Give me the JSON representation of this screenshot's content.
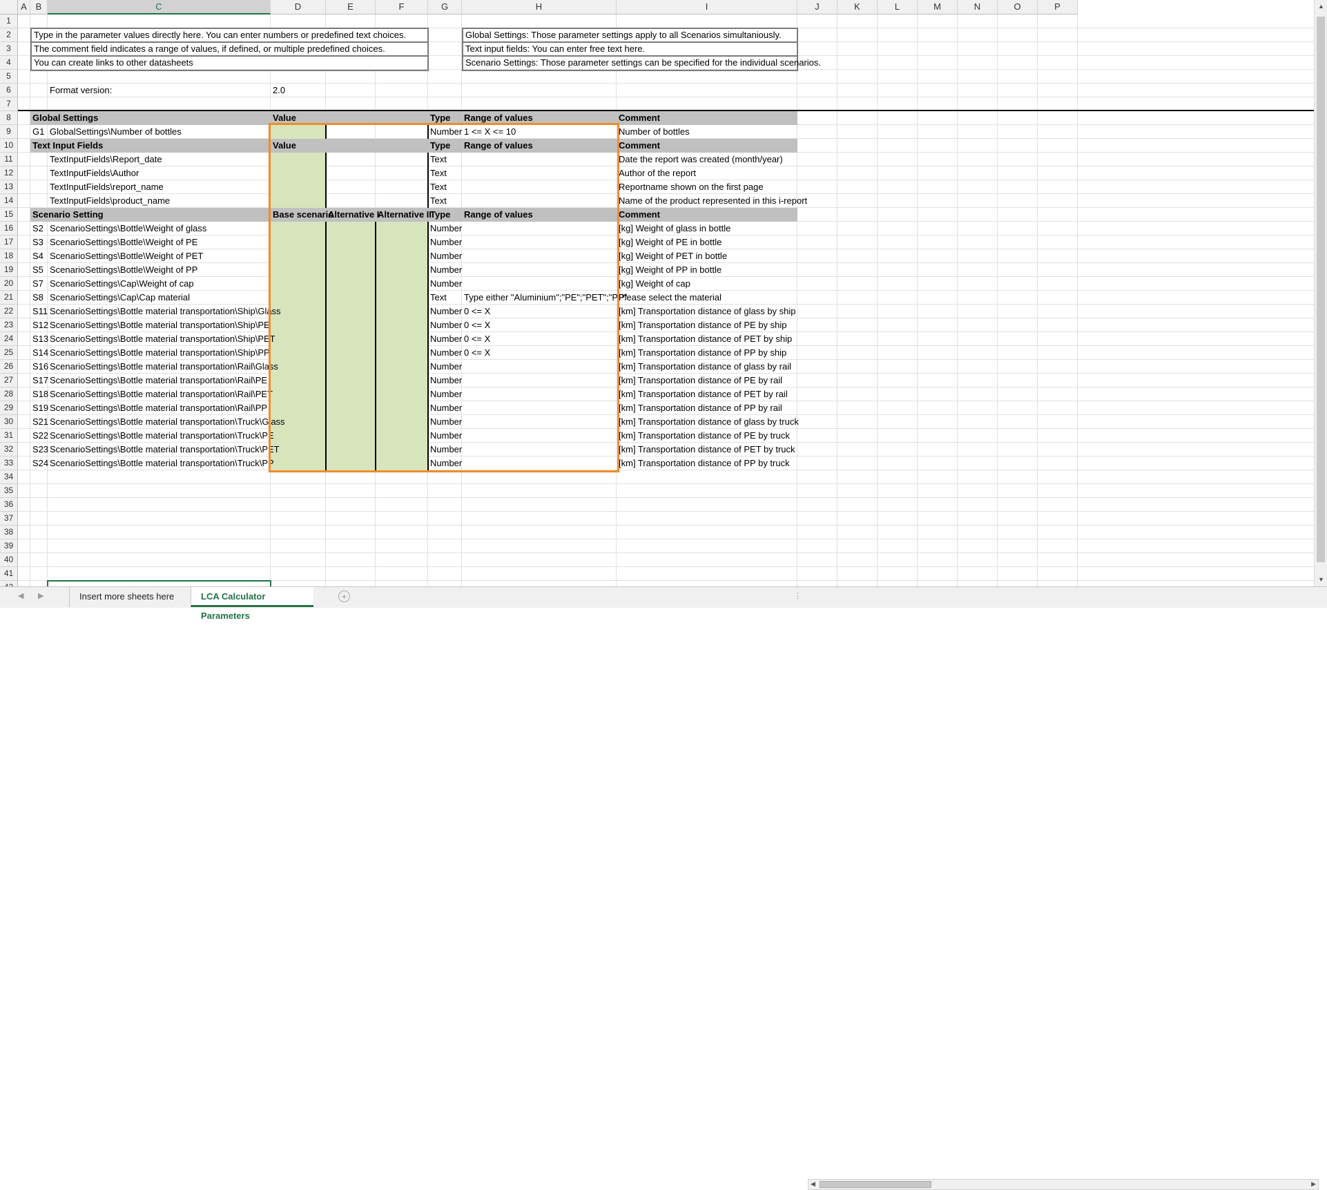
{
  "columns": [
    "A",
    "B",
    "C",
    "D",
    "E",
    "F",
    "G",
    "H",
    "I",
    "J",
    "K",
    "L",
    "M",
    "N",
    "O",
    "P"
  ],
  "row_numbers": [
    "1",
    "2",
    "3",
    "4",
    "5",
    "6",
    "7",
    "8",
    "9",
    "10",
    "11",
    "12",
    "13",
    "14",
    "15",
    "16",
    "17",
    "18",
    "19",
    "20",
    "21",
    "22",
    "23",
    "24",
    "25",
    "26",
    "27",
    "28",
    "29",
    "30",
    "31",
    "32",
    "33",
    "34",
    "35",
    "36",
    "37",
    "38",
    "39",
    "40",
    "41",
    "42"
  ],
  "info_left": [
    "Type in the parameter values directly here. You can enter numbers or predefined text choices.",
    "The comment field indicates a range of values,  if defined,  or multiple predefined choices.",
    "You can create links to other datasheets"
  ],
  "info_right": [
    "Global Settings: Those parameter settings apply to all Scenarios simultaniously.",
    "Text input fields: You can enter free text here.",
    "Scenario Settings: Those parameter settings can be specified for the individual scenarios."
  ],
  "format_label": "Format version:",
  "format_value": "2.0",
  "headers": {
    "global": {
      "name": "Global Settings",
      "d": "Value",
      "e": "",
      "f": "",
      "type": "Type",
      "range": "Range of values",
      "comment": "Comment"
    },
    "text": {
      "name": "Text Input Fields",
      "d": "Value",
      "e": "",
      "f": "",
      "type": "Type",
      "range": "Range of values",
      "comment": "Comment"
    },
    "scenario": {
      "name": "Scenario Setting",
      "d": "Base scenario",
      "e": "Alternative I",
      "f": "Alternative II",
      "type": "Type",
      "range": "Range of values",
      "comment": "Comment"
    }
  },
  "global_rows": [
    {
      "id": "G1",
      "name": "GlobalSettings\\Number of bottles",
      "type": "Number",
      "range": "1 <= X <= 10",
      "comment": "Number of bottles"
    }
  ],
  "text_rows": [
    {
      "id": "",
      "name": "TextInputFields\\Report_date",
      "type": "Text",
      "range": "",
      "comment": "Date the report was created (month/year)"
    },
    {
      "id": "",
      "name": "TextInputFields\\Author",
      "type": "Text",
      "range": "",
      "comment": "Author of the report"
    },
    {
      "id": "",
      "name": "TextInputFields\\report_name",
      "type": "Text",
      "range": "",
      "comment": "Reportname shown on the first page"
    },
    {
      "id": "",
      "name": "TextInputFields\\product_name",
      "type": "Text",
      "range": "",
      "comment": "Name of the product represented in this i-report"
    }
  ],
  "scenario_rows": [
    {
      "id": "S2",
      "name": "ScenarioSettings\\Bottle\\Weight of glass",
      "type": "Number",
      "range": "",
      "comment": "[kg] Weight of glass in bottle"
    },
    {
      "id": "S3",
      "name": "ScenarioSettings\\Bottle\\Weight of PE",
      "type": "Number",
      "range": "",
      "comment": "[kg] Weight of PE in bottle"
    },
    {
      "id": "S4",
      "name": "ScenarioSettings\\Bottle\\Weight of PET",
      "type": "Number",
      "range": "",
      "comment": "[kg] Weight of PET in bottle"
    },
    {
      "id": "S5",
      "name": "ScenarioSettings\\Bottle\\Weight of PP",
      "type": "Number",
      "range": "",
      "comment": "[kg] Weight of PP in bottle"
    },
    {
      "id": "S7",
      "name": "ScenarioSettings\\Cap\\Weight of cap",
      "type": "Number",
      "range": "",
      "comment": "[kg] Weight of cap"
    },
    {
      "id": "S8",
      "name": "ScenarioSettings\\Cap\\Cap material",
      "type": "Text",
      "range": "Type either \"Aluminium\";\"PE\";\"PET\";\"PP\"",
      "comment": "Please select the material"
    },
    {
      "id": "S11",
      "name": "ScenarioSettings\\Bottle material transportation\\Ship\\Glass",
      "type": "Number",
      "range": "0 <= X",
      "comment": "[km] Transportation distance of glass by ship"
    },
    {
      "id": "S12",
      "name": "ScenarioSettings\\Bottle material transportation\\Ship\\PE",
      "type": "Number",
      "range": "0 <= X",
      "comment": "[km] Transportation distance of PE by ship"
    },
    {
      "id": "S13",
      "name": "ScenarioSettings\\Bottle material transportation\\Ship\\PET",
      "type": "Number",
      "range": "0 <= X",
      "comment": "[km] Transportation distance of PET by ship"
    },
    {
      "id": "S14",
      "name": "ScenarioSettings\\Bottle material transportation\\Ship\\PP",
      "type": "Number",
      "range": "0 <= X",
      "comment": "[km] Transportation distance of PP by ship"
    },
    {
      "id": "S16",
      "name": "ScenarioSettings\\Bottle material transportation\\Rail\\Glass",
      "type": "Number",
      "range": "",
      "comment": "[km] Transportation distance of glass by rail"
    },
    {
      "id": "S17",
      "name": "ScenarioSettings\\Bottle material transportation\\Rail\\PE",
      "type": "Number",
      "range": "",
      "comment": "[km] Transportation distance of PE by rail"
    },
    {
      "id": "S18",
      "name": "ScenarioSettings\\Bottle material transportation\\Rail\\PET",
      "type": "Number",
      "range": "",
      "comment": "[km] Transportation distance of PET by rail"
    },
    {
      "id": "S19",
      "name": "ScenarioSettings\\Bottle material transportation\\Rail\\PP",
      "type": "Number",
      "range": "",
      "comment": "[km] Transportation distance of PP by rail"
    },
    {
      "id": "S21",
      "name": "ScenarioSettings\\Bottle material transportation\\Truck\\Glass",
      "type": "Number",
      "range": "",
      "comment": "[km]  Transportation distance of glass by truck"
    },
    {
      "id": "S22",
      "name": "ScenarioSettings\\Bottle material transportation\\Truck\\PE",
      "type": "Number",
      "range": "",
      "comment": "[km]  Transportation distance of PE by truck"
    },
    {
      "id": "S23",
      "name": "ScenarioSettings\\Bottle material transportation\\Truck\\PET",
      "type": "Number",
      "range": "",
      "comment": "[km]  Transportation distance of PET by truck"
    },
    {
      "id": "S24",
      "name": "ScenarioSettings\\Bottle material transportation\\Truck\\PP",
      "type": "Number",
      "range": "",
      "comment": "[km]  Transportation distance of PP by truck"
    }
  ],
  "tabs": [
    {
      "label": "Insert more sheets here",
      "active": false
    },
    {
      "label": "LCA Calculator Parameters",
      "active": true
    }
  ],
  "selected_column": "C",
  "colors": {
    "accent": "#217346",
    "input_fill": "#d8e4bc",
    "header_fill": "#c0c0c0",
    "highlight_border": "#f08c28"
  }
}
